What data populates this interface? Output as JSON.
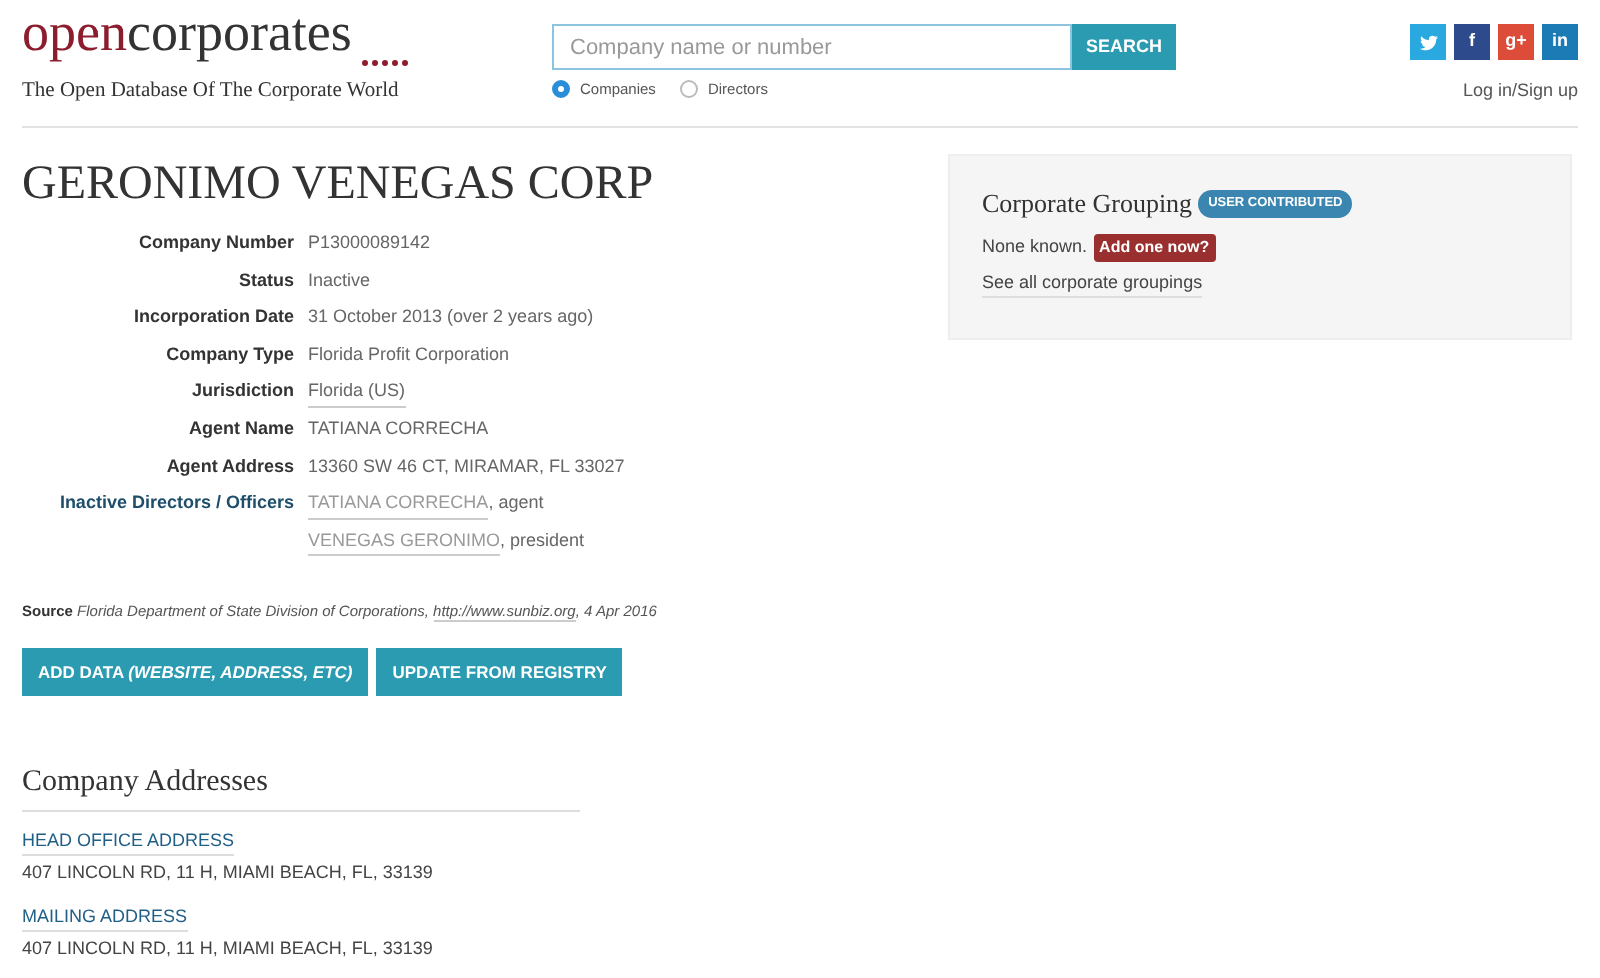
{
  "header": {
    "logo": {
      "part_1": "open",
      "part_2": "corporates"
    },
    "tagline": "The Open Database Of The Corporate World",
    "search": {
      "placeholder": "Company name or number",
      "button": "SEARCH"
    },
    "search_scope": [
      {
        "label": "Companies",
        "selected": true
      },
      {
        "label": "Directors",
        "selected": false
      }
    ],
    "social": [
      {
        "kind": "bird",
        "color": "#2aa9e0"
      },
      {
        "kind": "text",
        "text": "f",
        "color": "#2d4a8c"
      },
      {
        "kind": "text",
        "text": "g+",
        "color": "#dd4b39"
      },
      {
        "kind": "text",
        "text": "in",
        "color": "#1c7bb5"
      }
    ],
    "login": "Log in/Sign up"
  },
  "company": {
    "name": "GERONIMO VENEGAS CORP",
    "facts": [
      {
        "label": "Company Number",
        "kind": "text",
        "value": "P13000089142"
      },
      {
        "label": "Status",
        "kind": "text",
        "value": "Inactive"
      },
      {
        "label": "Incorporation Date",
        "kind": "text",
        "value": "31 October 2013 (over 2 years ago)"
      },
      {
        "label": "Company Type",
        "kind": "text",
        "value": "Florida Profit Corporation"
      },
      {
        "label": "Jurisdiction",
        "kind": "link",
        "value": "Florida (US)"
      },
      {
        "label": "Agent Name",
        "kind": "text",
        "value": "TATIANA CORRECHA"
      },
      {
        "label": "Agent Address",
        "kind": "text",
        "value": "13360 SW 46 CT, MIRAMAR, FL 33027"
      },
      {
        "label": "Inactive Directors / Officers",
        "kind": "officers",
        "officers": [
          {
            "name": "TATIANA CORRECHA",
            "role": ", agent"
          },
          {
            "name": "VENEGAS GERONIMO",
            "role": ", president"
          }
        ]
      }
    ],
    "source": {
      "label": "Source",
      "text": "Florida Department of State Division of Corporations, ",
      "link": "http://www.sunbiz.org",
      "date": ", 4 Apr 2016"
    },
    "buttons": [
      {
        "label": "ADD DATA ",
        "italic": "(WEBSITE, ADDRESS, ETC)"
      },
      {
        "label": "UPDATE FROM REGISTRY"
      }
    ]
  },
  "corporate_grouping": {
    "title": "Corporate Grouping",
    "badge": "USER CONTRIBUTED",
    "none_text": "None known.",
    "add_button": "Add one now?",
    "link": "See all corporate groupings"
  },
  "addresses": {
    "title": "Company Addresses",
    "items": [
      {
        "type": "HEAD OFFICE ADDRESS",
        "address": "407 LINCOLN RD, 11 H, MIAMI BEACH, FL, 33139"
      },
      {
        "type": "MAILING ADDRESS",
        "address": "407 LINCOLN RD, 11 H, MIAMI BEACH, FL, 33139"
      }
    ]
  }
}
